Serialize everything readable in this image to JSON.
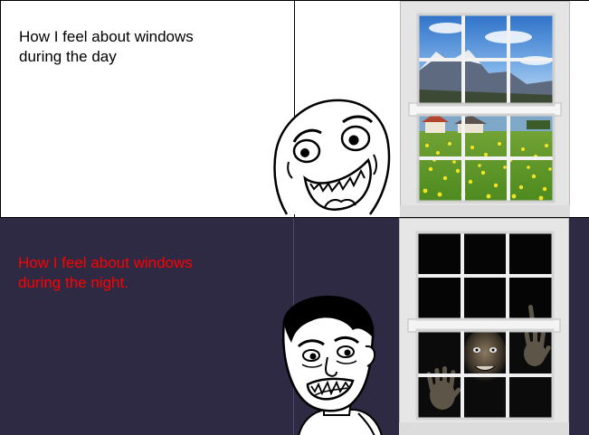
{
  "comic": {
    "panels": [
      {
        "caption": "How I feel about windows\nduring the day",
        "caption_color": "#000000",
        "background": "#ffffff",
        "face": "happy-rage-face",
        "window_view": "sunny-mountain-meadow"
      },
      {
        "caption": "How I feel about windows\nduring the night.",
        "caption_color": "#ff0000",
        "background": "#2e2a44",
        "face": "scared-rage-face",
        "window_view": "dark-night-with-creepy-face"
      }
    ]
  }
}
